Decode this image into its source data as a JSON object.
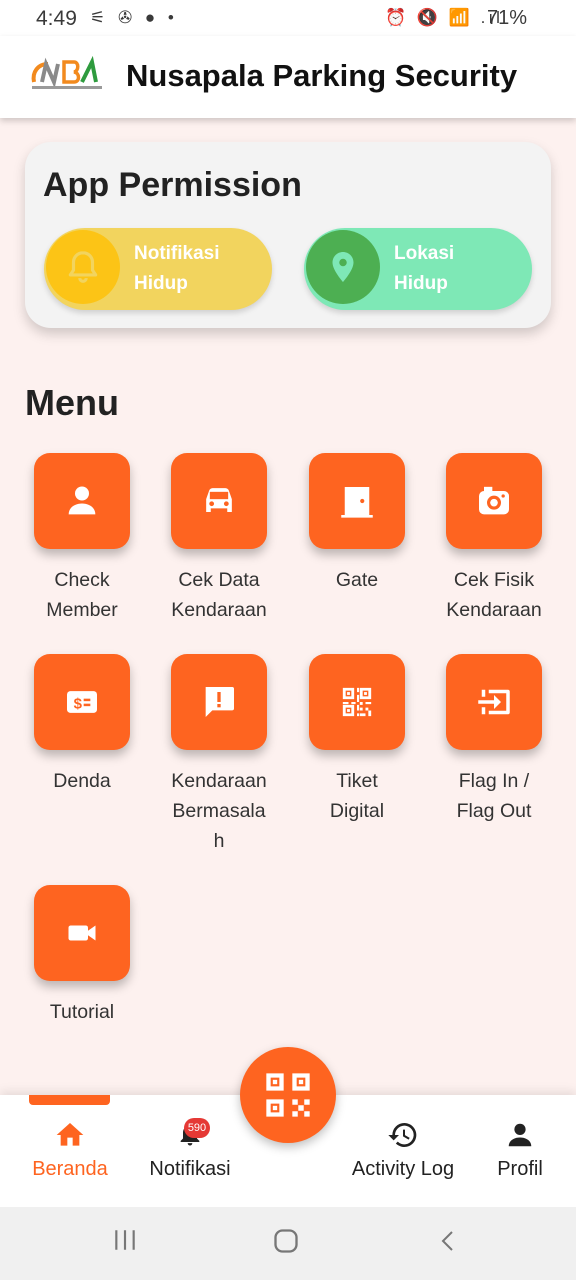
{
  "status_bar": {
    "time": "4:49",
    "battery": "71%",
    "left_icons": "⚟ ✇ ● •",
    "right_icons": "⏰ 🔇 📶 .ıl"
  },
  "app_bar": {
    "title": "Nusapala Parking Security",
    "logo_text": "NUSAPALA BERKAH AUTOSERVICE",
    "logo_letters": "NB"
  },
  "permission": {
    "title": "App Permission",
    "notification": {
      "line1": "Notifikasi",
      "line2": "Hidup",
      "icon": "bell-icon",
      "color": "#f2d45e"
    },
    "location": {
      "line1": "Lokasi",
      "line2": "Hidup",
      "icon": "location-pin-icon",
      "color": "#7ee8b6"
    }
  },
  "menu": {
    "title": "Menu",
    "items": [
      {
        "label": "Check\nMember",
        "icon": "person-icon"
      },
      {
        "label": "Cek Data\nKendaraan",
        "icon": "car-icon"
      },
      {
        "label": "Gate",
        "icon": "door-icon"
      },
      {
        "label": "Cek Fisik\nKendaraan",
        "icon": "camera-icon"
      },
      {
        "label": "Denda",
        "icon": "money-icon"
      },
      {
        "label": "Kendaraan\nBermasala\nh",
        "icon": "alert-message-icon"
      },
      {
        "label": "Tiket\nDigital",
        "icon": "qr-code-icon"
      },
      {
        "label": "Flag In /\nFlag Out",
        "icon": "input-icon"
      },
      {
        "label": "Tutorial",
        "icon": "video-icon"
      }
    ]
  },
  "bottom_nav": {
    "items": [
      {
        "label": "Beranda",
        "icon": "home-icon",
        "active": true
      },
      {
        "label": "Notifikasi",
        "icon": "bell-icon",
        "badge": "590"
      },
      {
        "label": "Activity Log",
        "icon": "history-icon"
      },
      {
        "label": "Profil",
        "icon": "person-icon"
      }
    ],
    "fab_icon": "qr-code-icon"
  },
  "colors": {
    "accent": "#fe6420",
    "background": "#fdf1ef"
  }
}
